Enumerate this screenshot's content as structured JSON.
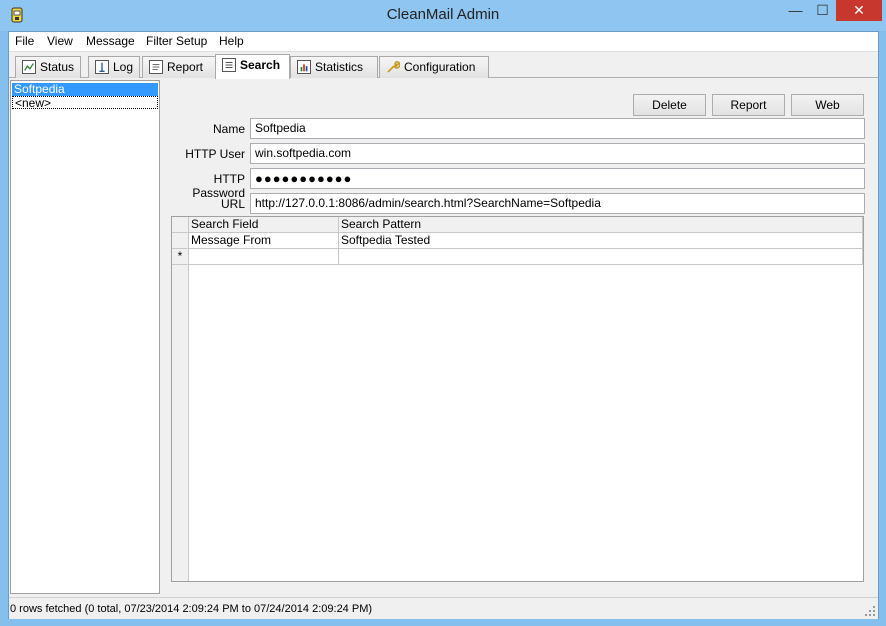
{
  "window": {
    "title": "CleanMail Admin"
  },
  "menu": [
    "File",
    "View",
    "Message",
    "Filter Setup",
    "Help"
  ],
  "tabs": [
    {
      "label": "Status",
      "icon": "status-chart-icon"
    },
    {
      "label": "Log",
      "icon": "log-icon"
    },
    {
      "label": "Report",
      "icon": "report-icon"
    },
    {
      "label": "Search",
      "icon": "search-doc-icon",
      "active": true
    },
    {
      "label": "Statistics",
      "icon": "statistics-bar-icon"
    },
    {
      "label": "Configuration",
      "icon": "wrench-icon"
    }
  ],
  "searches": {
    "items": [
      "Softpedia",
      "<new>"
    ],
    "selected": "Softpedia"
  },
  "buttons": {
    "delete": "Delete",
    "report": "Report",
    "web": "Web"
  },
  "form": {
    "name_label": "Name",
    "name_value": "Softpedia",
    "http_user_label": "HTTP User",
    "http_user_value": "win.softpedia.com",
    "http_password_label": "HTTP Password",
    "http_password_value": "●●●●●●●●●●●",
    "url_label": "URL",
    "url_value": "http://127.0.0.1:8086/admin/search.html?SearchName=Softpedia"
  },
  "grid": {
    "headers": [
      "Search Field",
      "Search Pattern"
    ],
    "rows": [
      [
        "Message From",
        "Softpedia Tested"
      ]
    ],
    "new_row_marker": "*"
  },
  "status": {
    "text": "0 rows fetched (0 total, 07/23/2014 2:09:24 PM to 07/24/2014 2:09:24 PM)"
  },
  "colors": {
    "selection": "#3399ff",
    "titlebar": "#8ec6f1",
    "close_button": "#c7372e"
  }
}
